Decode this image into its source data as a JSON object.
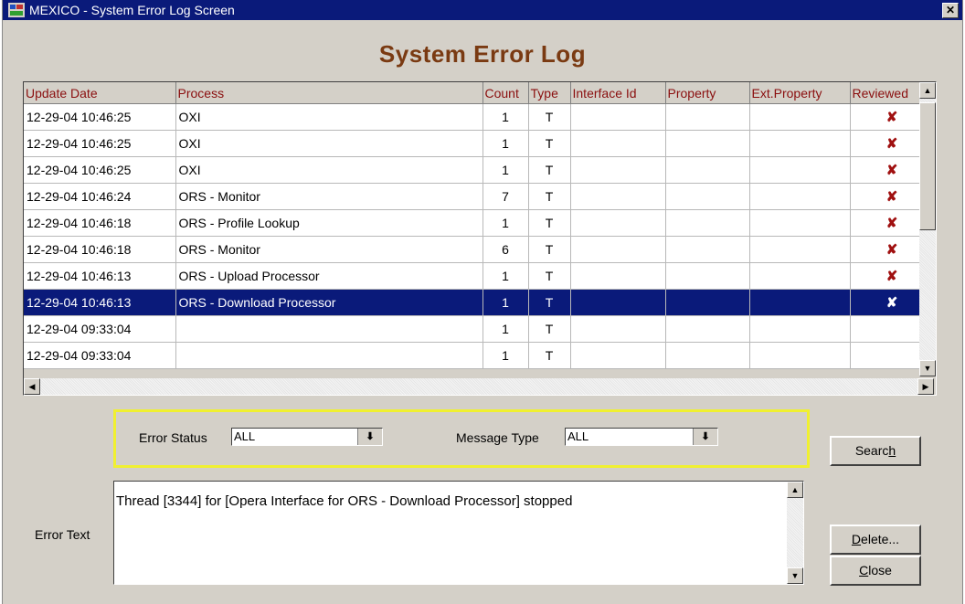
{
  "window": {
    "title": "MEXICO - System Error Log Screen",
    "close_glyph": "✕"
  },
  "heading": "System Error Log",
  "table": {
    "columns": [
      "Update Date",
      "Process",
      "Count",
      "Type",
      "Interface Id",
      "Property",
      "Ext.Property",
      "Reviewed"
    ],
    "rows": [
      {
        "update_date": "12-29-04 10:46:25",
        "process": "OXI",
        "count": "1",
        "type": "T",
        "interface_id": "",
        "property": "",
        "ext_property": "",
        "reviewed": "✘"
      },
      {
        "update_date": "12-29-04 10:46:25",
        "process": "OXI",
        "count": "1",
        "type": "T",
        "interface_id": "",
        "property": "",
        "ext_property": "",
        "reviewed": "✘"
      },
      {
        "update_date": "12-29-04 10:46:25",
        "process": "OXI",
        "count": "1",
        "type": "T",
        "interface_id": "",
        "property": "",
        "ext_property": "",
        "reviewed": "✘"
      },
      {
        "update_date": "12-29-04 10:46:24",
        "process": "ORS - Monitor",
        "count": "7",
        "type": "T",
        "interface_id": "",
        "property": "",
        "ext_property": "",
        "reviewed": "✘"
      },
      {
        "update_date": "12-29-04 10:46:18",
        "process": "ORS - Profile Lookup",
        "count": "1",
        "type": "T",
        "interface_id": "",
        "property": "",
        "ext_property": "",
        "reviewed": "✘"
      },
      {
        "update_date": "12-29-04 10:46:18",
        "process": "ORS - Monitor",
        "count": "6",
        "type": "T",
        "interface_id": "",
        "property": "",
        "ext_property": "",
        "reviewed": "✘"
      },
      {
        "update_date": "12-29-04 10:46:13",
        "process": "ORS - Upload Processor",
        "count": "1",
        "type": "T",
        "interface_id": "",
        "property": "",
        "ext_property": "",
        "reviewed": "✘"
      },
      {
        "update_date": "12-29-04 10:46:13",
        "process": "ORS - Download Processor",
        "count": "1",
        "type": "T",
        "interface_id": "",
        "property": "",
        "ext_property": "",
        "reviewed": "✘",
        "selected": true
      },
      {
        "update_date": "12-29-04 09:33:04",
        "process": "",
        "count": "1",
        "type": "T",
        "interface_id": "",
        "property": "",
        "ext_property": "",
        "reviewed": ""
      },
      {
        "update_date": "12-29-04 09:33:04",
        "process": "",
        "count": "1",
        "type": "T",
        "interface_id": "",
        "property": "",
        "ext_property": "",
        "reviewed": ""
      }
    ]
  },
  "filters": {
    "error_status_label": "Error Status",
    "error_status_value": "ALL",
    "message_type_label": "Message Type",
    "message_type_value": "ALL"
  },
  "buttons": {
    "search": {
      "pre": "Searc",
      "mnemonic": "h",
      "post": ""
    },
    "delete": {
      "pre": "",
      "mnemonic": "D",
      "post": "elete..."
    },
    "close": {
      "pre": "",
      "mnemonic": "C",
      "post": "lose"
    }
  },
  "error_text": {
    "label": "Error Text",
    "value": "Thread [3344] for [Opera Interface for ORS - Download Processor] stopped"
  },
  "colors": {
    "title_bar": "#0a1a7a",
    "heading": "#7a3a12",
    "column_header_text": "#8a0e0e",
    "selection": "#0a1a7a",
    "reviewed_mark": "#a01010",
    "filter_highlight": "#f0f030"
  }
}
